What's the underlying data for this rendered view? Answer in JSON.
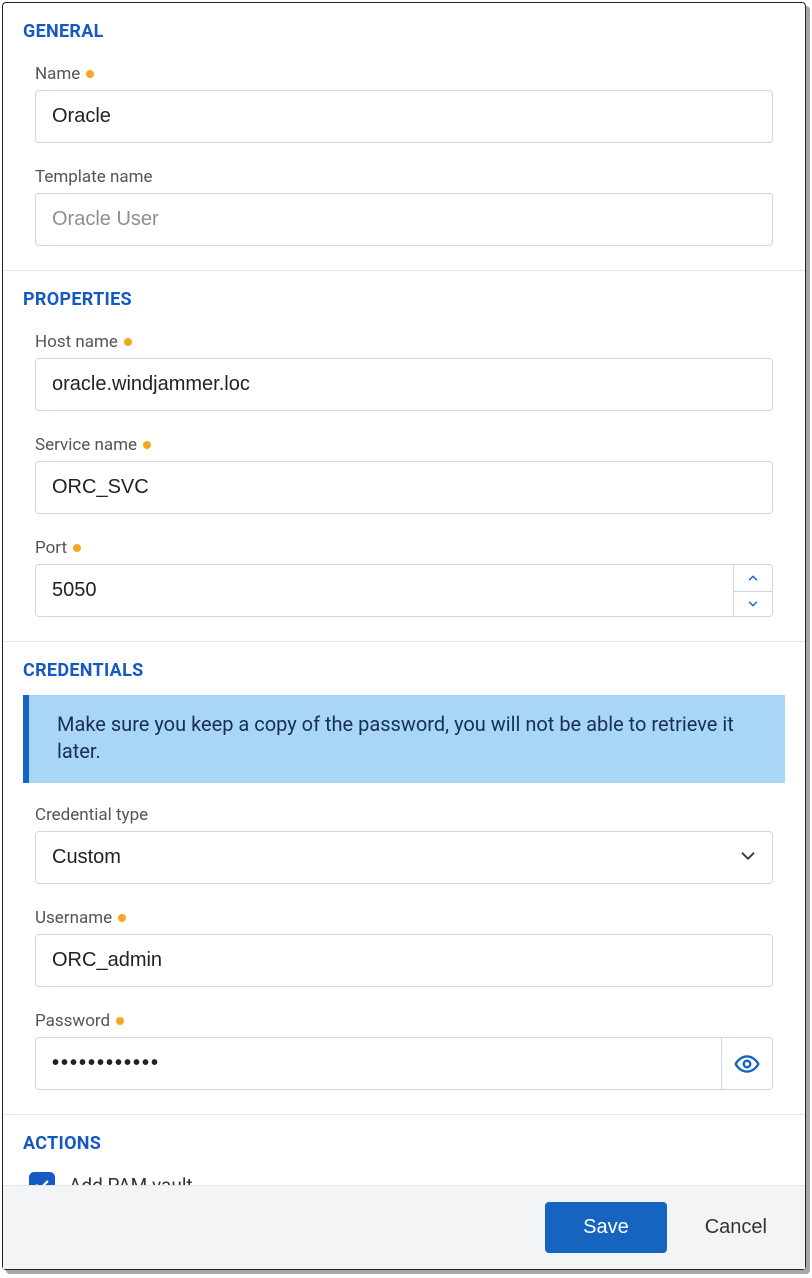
{
  "general": {
    "title": "GENERAL",
    "name_label": "Name",
    "name_value": "Oracle",
    "template_label": "Template name",
    "template_value": "Oracle User"
  },
  "properties": {
    "title": "PROPERTIES",
    "host_label": "Host name",
    "host_value": "oracle.windjammer.loc",
    "service_label": "Service name",
    "service_value": "ORC_SVC",
    "port_label": "Port",
    "port_value": "5050"
  },
  "credentials": {
    "title": "CREDENTIALS",
    "notice": "Make sure you keep a copy of the password, you will not be able to retrieve it later.",
    "type_label": "Credential type",
    "type_value": "Custom",
    "username_label": "Username",
    "username_value": "ORC_admin",
    "password_label": "Password",
    "password_value": "••••••••••••"
  },
  "actions": {
    "title": "ACTIONS",
    "add_pam_label": "Add PAM vault",
    "add_pam_checked": true
  },
  "footer": {
    "save_label": "Save",
    "cancel_label": "Cancel"
  }
}
